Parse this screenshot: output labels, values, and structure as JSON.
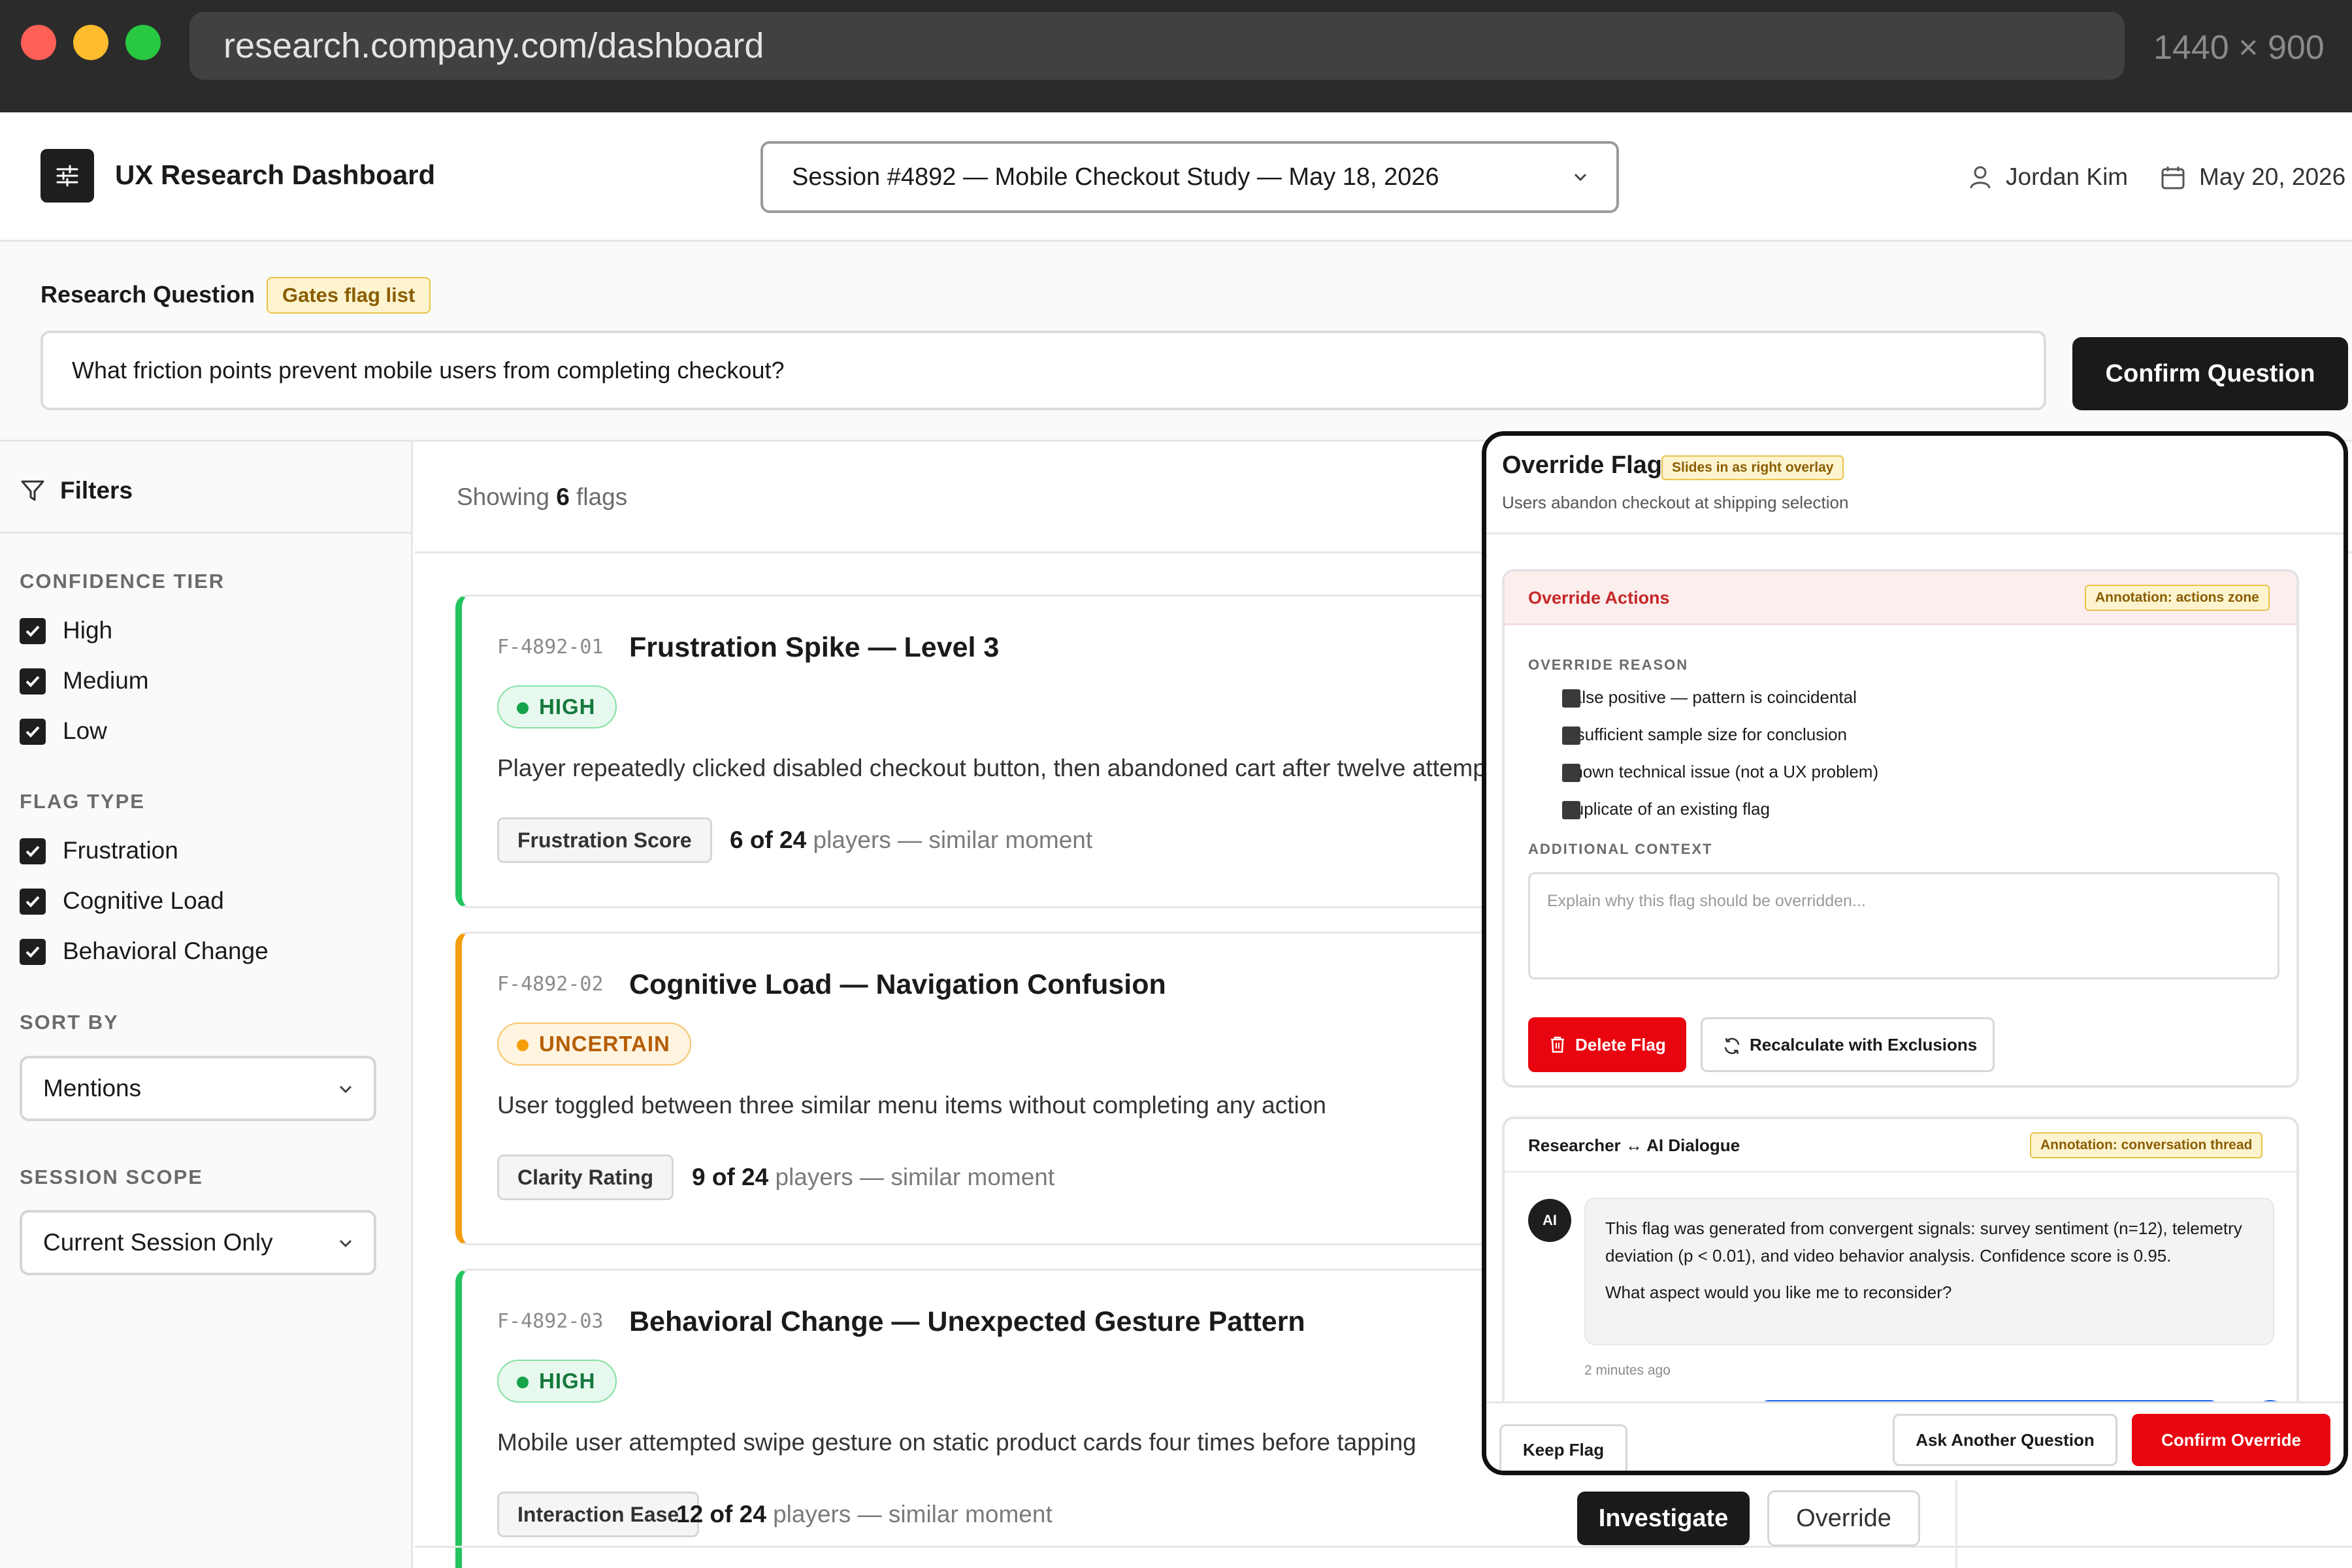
{
  "browser": {
    "url": "research.company.com/dashboard",
    "viewport_label": "1440 × 900"
  },
  "header": {
    "app_title": "UX Research Dashboard",
    "session_select": "Session #4892 — Mobile Checkout Study — May 18, 2026",
    "user_name": "Jordan Kim",
    "date": "May 20, 2026"
  },
  "research_question": {
    "label": "Research Question",
    "annotation": "Gates flag list",
    "value": "What friction points prevent mobile users from completing checkout?",
    "confirm_label": "Confirm Question"
  },
  "sidebar": {
    "title": "Filters",
    "confidence_heading": "CONFIDENCE TIER",
    "confidence_options": [
      {
        "label": "High",
        "checked": true
      },
      {
        "label": "Medium",
        "checked": true
      },
      {
        "label": "Low",
        "checked": true
      }
    ],
    "flag_type_heading": "FLAG TYPE",
    "flag_type_options": [
      {
        "label": "Frustration",
        "checked": true
      },
      {
        "label": "Cognitive Load",
        "checked": true
      },
      {
        "label": "Behavioral Change",
        "checked": true
      }
    ],
    "sort_heading": "SORT BY",
    "sort_value": "Mentions",
    "scope_heading": "SESSION SCOPE",
    "scope_value": "Current Session Only"
  },
  "main": {
    "showing_prefix": "Showing",
    "showing_count": "6",
    "showing_suffix": "flags",
    "flags": [
      {
        "id": "F-4892-01",
        "title": "Frustration Spike — Level 3",
        "confidence": "HIGH",
        "description": "Player repeatedly clicked disabled checkout button, then abandoned cart after twelve attempts",
        "metric": "Frustration Score",
        "count": "6 of 24",
        "count_suffix": "players — similar moment"
      },
      {
        "id": "F-4892-02",
        "title": "Cognitive Load — Navigation Confusion",
        "confidence": "UNCERTAIN",
        "description": "User toggled between three similar menu items without completing any action",
        "metric": "Clarity Rating",
        "count": "9 of 24",
        "count_suffix": "players — similar moment"
      },
      {
        "id": "F-4892-03",
        "title": "Behavioral Change — Unexpected Gesture Pattern",
        "confidence": "HIGH",
        "description": "Mobile user attempted swipe gesture on static product cards four times before tapping",
        "metric": "Interaction Ease",
        "count": "12 of 24",
        "count_suffix": "players — similar moment"
      }
    ],
    "investigate_label": "Investigate",
    "override_label": "Override"
  },
  "overlay": {
    "title": "Override Flag",
    "annotation": "Slides in as right overlay",
    "subtitle": "Users abandon checkout at shipping selection",
    "actions": {
      "title": "Override Actions",
      "annotation": "Annotation: actions zone",
      "reason_heading": "OVERRIDE REASON",
      "reasons": [
        "False positive — pattern is coincidental",
        "Insufficient sample size for conclusion",
        "Known technical issue (not a UX problem)",
        "Duplicate of an existing flag"
      ],
      "context_heading": "ADDITIONAL CONTEXT",
      "context_placeholder": "Explain why this flag should be overridden...",
      "delete_label": "Delete Flag",
      "recalc_label": "Recalculate with Exclusions"
    },
    "dialogue": {
      "title": "Researcher ↔ AI Dialogue",
      "annotation": "Annotation: conversation thread",
      "avatar": "AI",
      "message_p1": "This flag was generated from convergent signals: survey sentiment (n=12), telemetry deviation (p < 0.01), and video behavior analysis. Confidence score is 0.95.",
      "message_p2": "What aspect would you like me to reconsider?",
      "time": "2 minutes ago"
    },
    "footer": {
      "keep_label": "Keep Flag",
      "ask_label": "Ask Another Question",
      "confirm_label": "Confirm Override"
    }
  },
  "colors": {
    "accent_red": "#e8050f",
    "high_green": "#22c55e",
    "uncertain_amber": "#f59e0b",
    "annotation_yellow": "#fdf4cf"
  }
}
